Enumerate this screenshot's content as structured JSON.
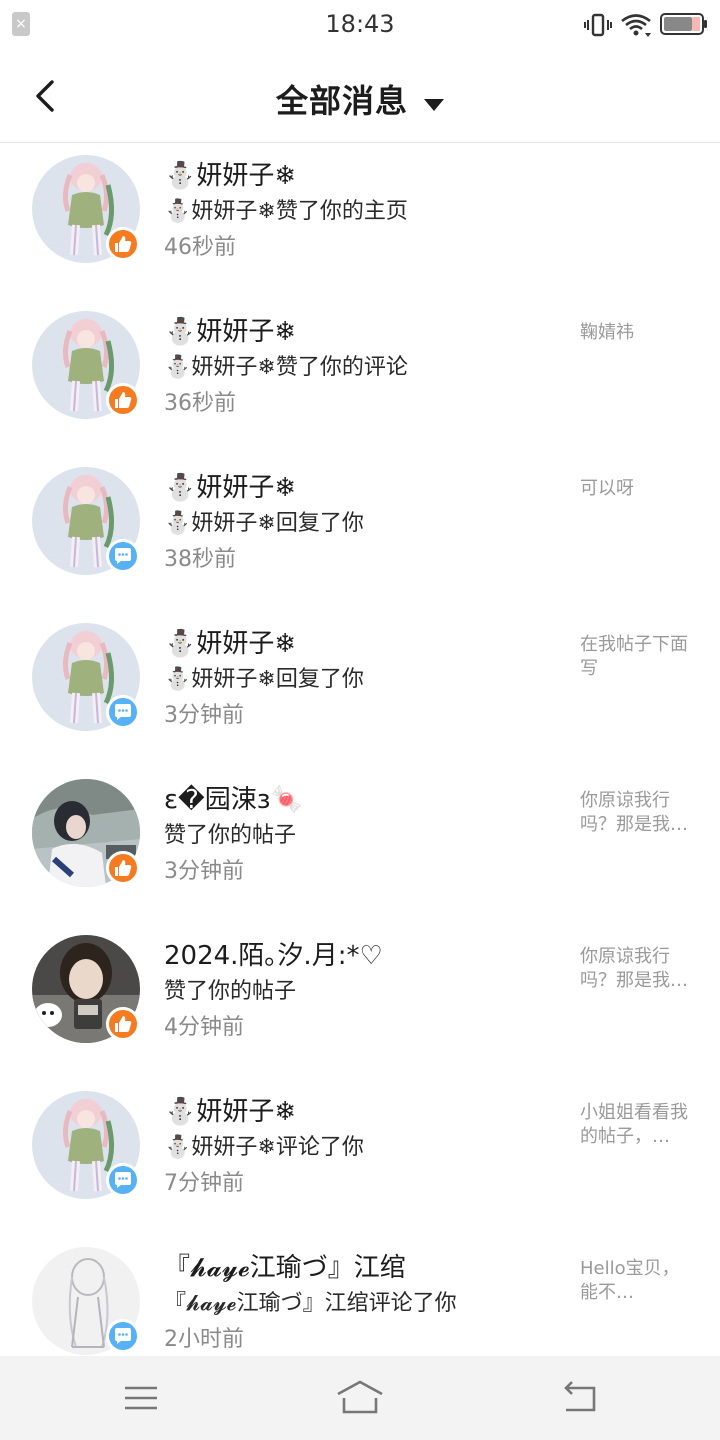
{
  "status_bar": {
    "time": "18:43"
  },
  "header": {
    "title": "全部消息"
  },
  "messages": [
    {
      "name": "⛄妍妍子❄",
      "action": "⛄妍妍子❄赞了你的主页",
      "time": "46秒前",
      "preview": "",
      "badge": "like",
      "avatar": "anime-figure"
    },
    {
      "name": "⛄妍妍子❄",
      "action": "⛄妍妍子❄赞了你的评论",
      "time": "36秒前",
      "preview": "鞠婧祎",
      "badge": "like",
      "avatar": "anime-figure"
    },
    {
      "name": "⛄妍妍子❄",
      "action": "⛄妍妍子❄回复了你",
      "time": "38秒前",
      "preview": "可以呀",
      "badge": "reply",
      "avatar": "anime-figure"
    },
    {
      "name": "⛄妍妍子❄",
      "action": "⛄妍妍子❄回复了你",
      "time": "3分钟前",
      "preview": "在我帖子下面写",
      "badge": "reply",
      "avatar": "anime-figure"
    },
    {
      "name": "ε�园涑з🍬",
      "action": "赞了你的帖子",
      "time": "3分钟前",
      "preview": "你原谅我行吗？那是我…",
      "badge": "like",
      "avatar": "photo-girl"
    },
    {
      "name": "2024.陌｡汐.月:*♡",
      "action": "赞了你的帖子",
      "time": "4分钟前",
      "preview": "你原谅我行吗？那是我…",
      "badge": "like",
      "avatar": "photo-selfie"
    },
    {
      "name": "⛄妍妍子❄",
      "action": "⛄妍妍子❄评论了你",
      "time": "7分钟前",
      "preview": "小姐姐看看我的帖子，…",
      "badge": "reply",
      "avatar": "anime-figure"
    },
    {
      "name": "『𝓱𝓪𝔂𝓮江瑜づ』江绾",
      "action": "『𝓱𝓪𝔂𝓮江瑜づ』江绾评论了你",
      "time": "2小时前",
      "preview": "Hello宝贝，能不…",
      "badge": "reply",
      "avatar": "sketch-figure"
    }
  ],
  "colors": {
    "like_badge": "#f57b20",
    "reply_badge": "#57b1f5",
    "time_text": "#8a8a8a"
  },
  "icons": {
    "status": [
      "notification-close-icon",
      "vibrate-icon",
      "wifi-icon",
      "battery-icon"
    ],
    "nav": [
      "menu-icon",
      "home-icon",
      "back-nav-icon"
    ]
  }
}
